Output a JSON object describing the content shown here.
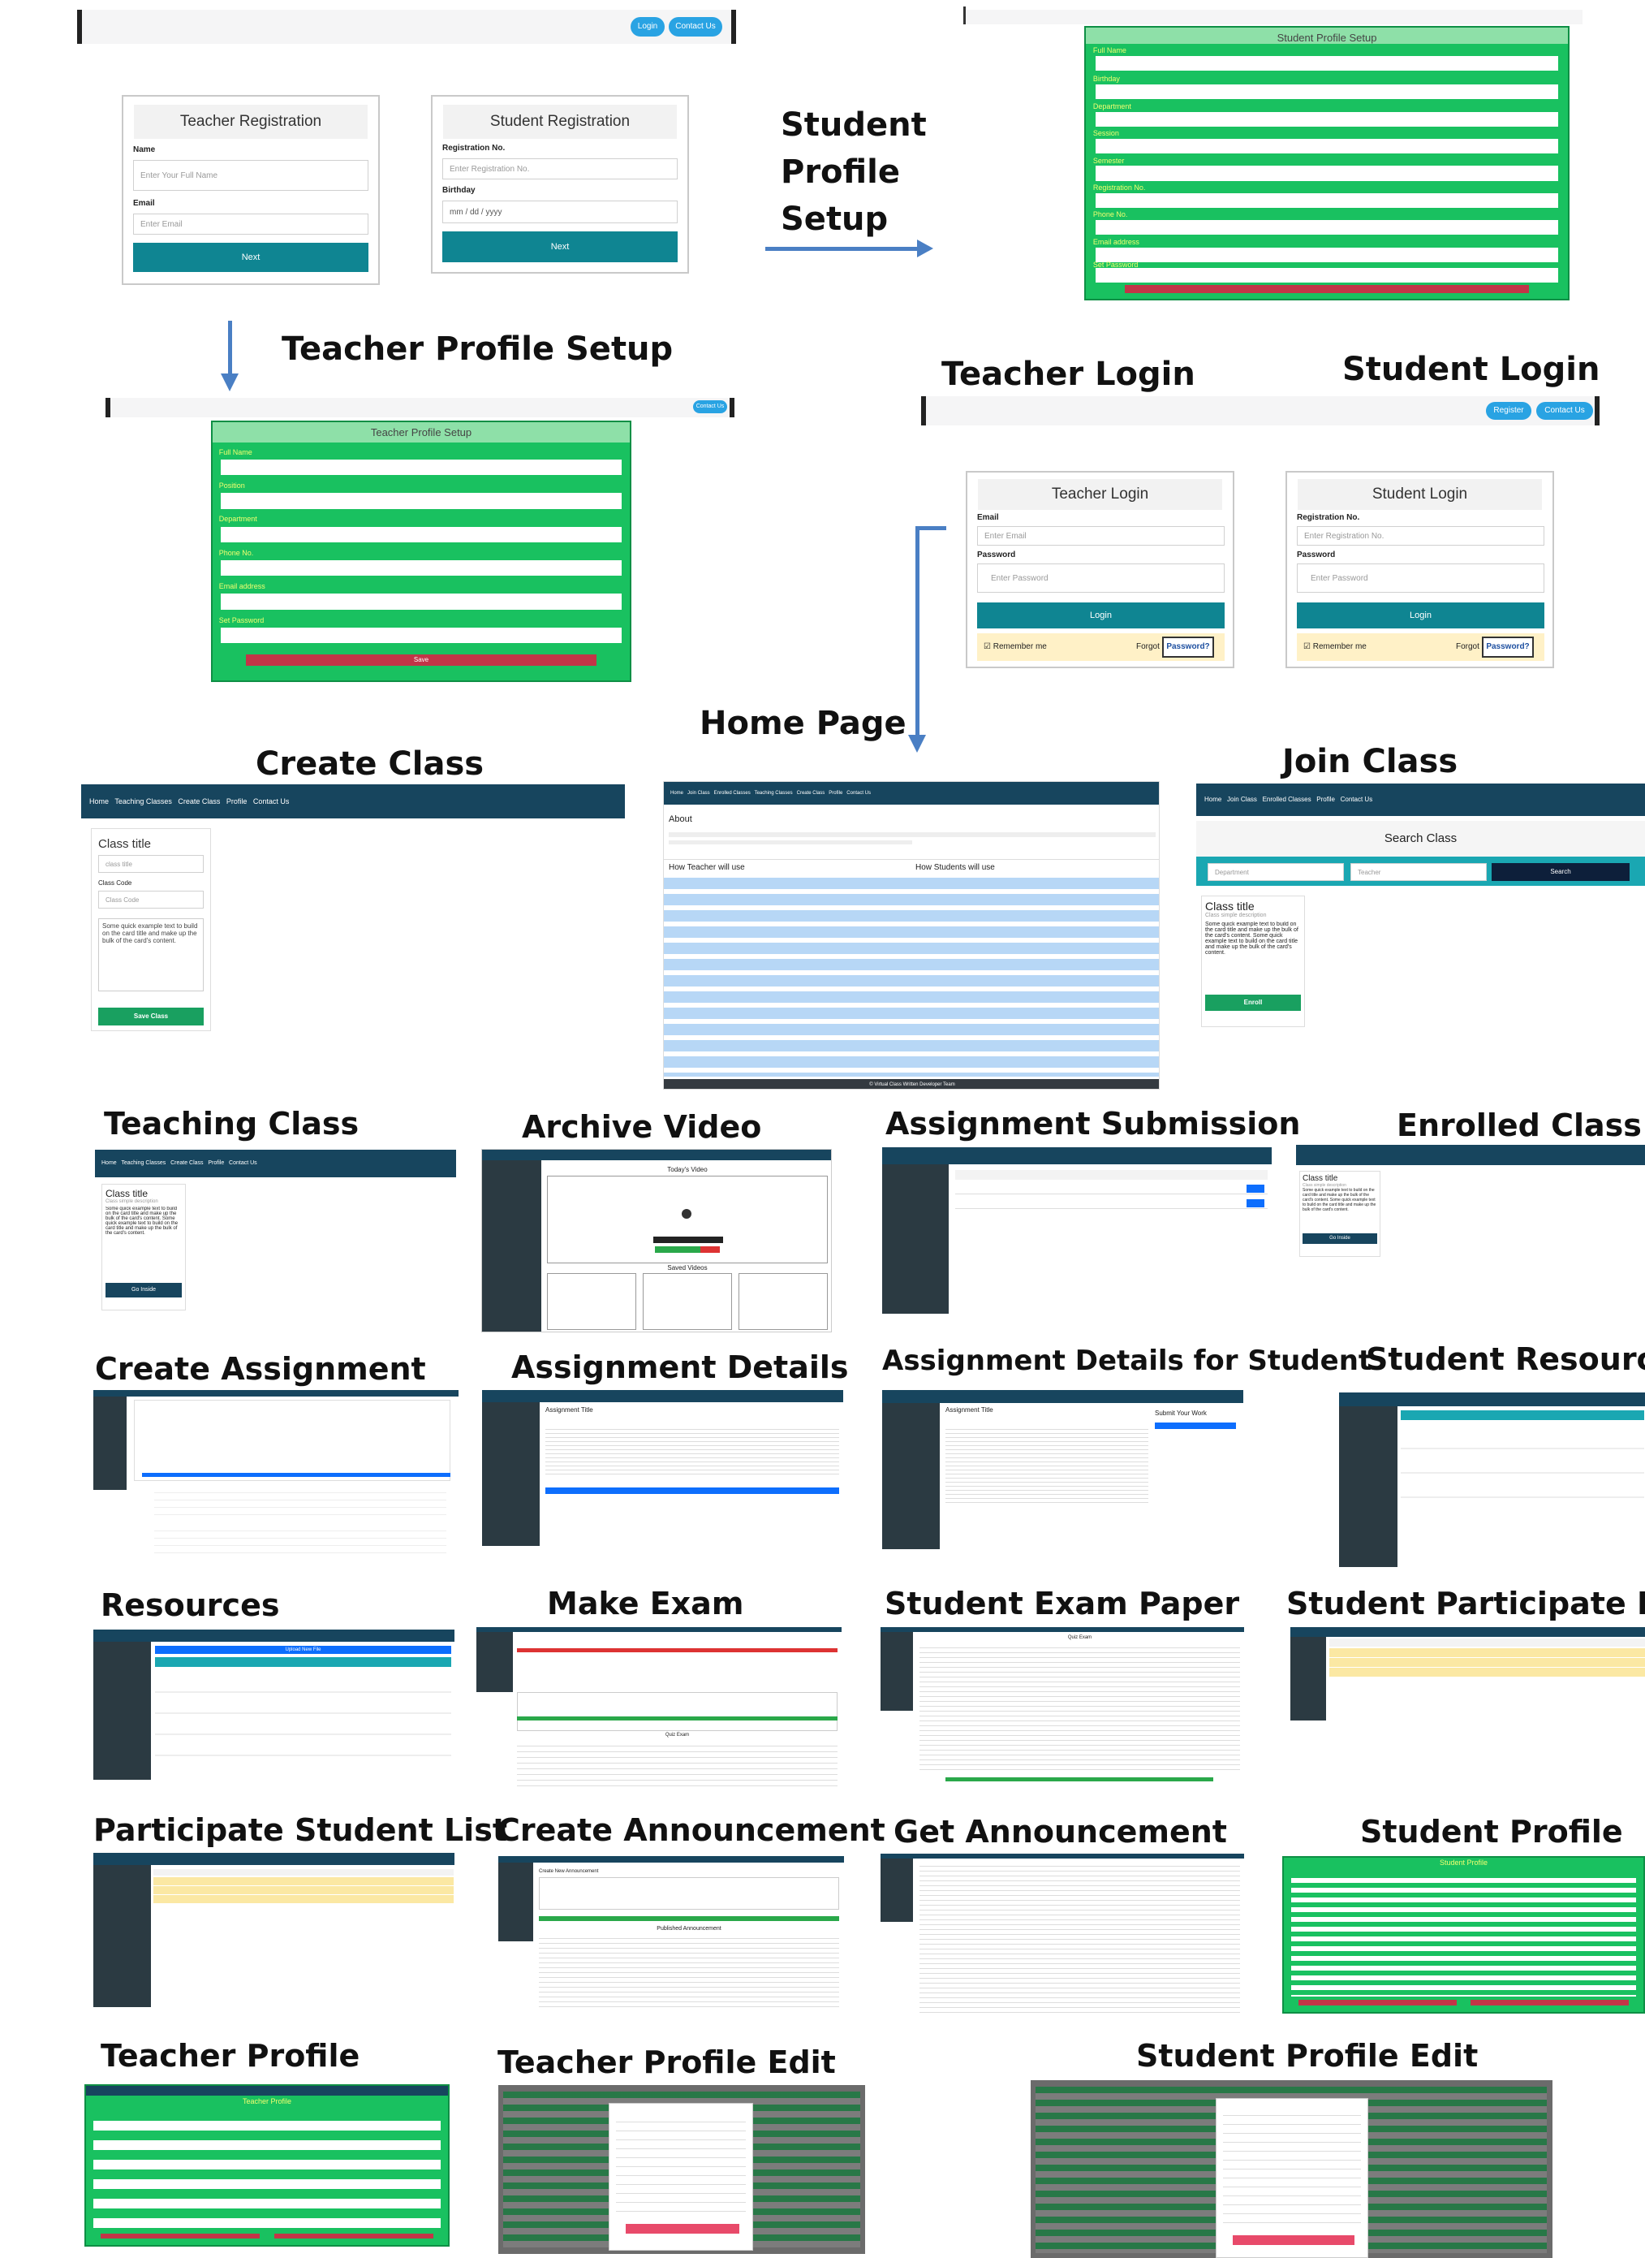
{
  "sections": {
    "student_profile_setup": "Student\nProfile\nSetup",
    "teacher_profile_setup": "Teacher Profile Setup",
    "teacher_login": "Teacher Login",
    "student_login": "Student Login",
    "home_page": "Home Page",
    "create_class": "Create Class",
    "join_class": "Join Class",
    "teaching_class": "Teaching Class",
    "archive_video": "Archive Video",
    "assignment_submission": "Assignment Submission",
    "enrolled_class": "Enrolled Class",
    "create_assignment": "Create Assignment",
    "assignment_details": "Assignment Details",
    "assignment_details_student": "Assignment Details for Student",
    "student_resource": "Student Resource",
    "resources": "Resources",
    "make_exam": "Make Exam",
    "student_exam_paper": "Student Exam Paper",
    "student_participate_list": "Student Participate Lis",
    "participate_student_list": "Participate Student List",
    "create_announcement": "Create Announcement",
    "get_announcement": "Get Announcement",
    "student_profile": "Student Profile",
    "teacher_profile": "Teacher Profile",
    "teacher_profile_edit": "Teacher Profile Edit",
    "student_profile_edit": "Student Profile Edit"
  },
  "top_nav": {
    "login": "Login",
    "contact": "Contact Us",
    "register": "Register"
  },
  "teacher_registration": {
    "title": "Teacher Registration",
    "name_label": "Name",
    "name_placeholder": "Enter Your Full Name",
    "email_label": "Email",
    "email_placeholder": "Enter Email",
    "next": "Next"
  },
  "student_registration": {
    "title": "Student Registration",
    "reg_label": "Registration No.",
    "reg_placeholder": "Enter Registration No.",
    "birthday_label": "Birthday",
    "birthday_placeholder": "mm / dd / yyyy",
    "next": "Next"
  },
  "student_profile_form": {
    "title": "Student Profile Setup",
    "fields": [
      "Full Name",
      "Birthday",
      "Department",
      "Session",
      "Semester",
      "Registration No.",
      "Phone No.",
      "Email address",
      "Set Password"
    ],
    "save": "Save"
  },
  "teacher_profile_form": {
    "title": "Teacher Profile Setup",
    "fields": [
      "Full Name",
      "Position",
      "Department",
      "Phone No.",
      "Email address",
      "Set Password"
    ],
    "save": "Save"
  },
  "teacher_login_card": {
    "title": "Teacher Login",
    "email_label": "Email",
    "email_placeholder": "Enter Email",
    "password_label": "Password",
    "password_placeholder": "Enter Password",
    "login": "Login",
    "remember": "☑ Remember me",
    "forgot": "Forgot",
    "password_btn": "Password?"
  },
  "student_login_card": {
    "title": "Student Login",
    "reg_label": "Registration No.",
    "reg_placeholder": "Enter Registration No.",
    "password_label": "Password",
    "password_placeholder": "Enter Password",
    "login": "Login",
    "remember": "☑ Remember me",
    "forgot": "Forgot",
    "password_btn": "Password?"
  },
  "home_shot": {
    "nav": "Home   Join Class   Enrolled Classes   Teaching Classes   Create Class   Profile   Contact Us",
    "about": "About",
    "teacher_col": "How Teacher will use",
    "student_col": "How Students will use",
    "footer": "© Virtual Class Written Developer Team"
  },
  "create_class_shot": {
    "nav": "Home   Teaching Classes   Create Class   Profile   Contact Us",
    "title_label": "Class title",
    "title_placeholder": "class title",
    "code_label": "Class Code",
    "code_placeholder": "Class Code",
    "text": "Some quick example text to build on the card title and make up the bulk of the card's content.",
    "save": "Save Class"
  },
  "join_class_shot": {
    "nav": "Home   Join Class   Enrolled Classes   Profile   Contact Us",
    "search_title": "Search Class",
    "department": "Department",
    "teacher": "Teacher",
    "search": "Search",
    "card_title": "Class title",
    "card_sub": "Class simple description",
    "card_text": "Some quick example text to build on the card title and make up the bulk of the card's content. Some quick example text to build on the card title and make up the bulk of the card's content.",
    "enroll": "Enroll"
  },
  "teaching_class_shot": {
    "nav": "Home   Teaching Classes   Create Class   Profile   Contact Us",
    "card_title": "Class title",
    "card_sub": "Class simple description",
    "card_text": "Some quick example text to build on the card title and make up the bulk of the card's content. Some quick example text to build on the card title and make up the bulk of the card's content.",
    "go": "Go Inside"
  },
  "enrolled_class_shot": {
    "card_title": "Class title",
    "card_sub": "Class simple description",
    "card_text": "Some quick example text to build on the card title and make up the bulk of the card's content. Some quick example text to build on the card title and make up the bulk of the card's content.",
    "go": "Go Inside"
  },
  "archive_video_shot": {
    "today": "Today's Video",
    "saved": "Saved Videos"
  },
  "assignment_details_shot": {
    "title": "Assignment Title"
  },
  "student_assignment_shot": {
    "title": "Assignment Title",
    "submit": "Submit Your Work"
  },
  "resources_shot": {
    "header": "Upload New File"
  },
  "make_exam_shot": {
    "title": "Quiz Exam"
  },
  "student_exam_shot": {
    "title": "Quiz Exam"
  },
  "create_announcement_shot": {
    "create": "Create New Announcement",
    "published": "Published Announcement"
  },
  "student_profile_shot": {
    "title": "Student Profile"
  },
  "teacher_profile_shot": {
    "title": "Teacher Profile"
  }
}
